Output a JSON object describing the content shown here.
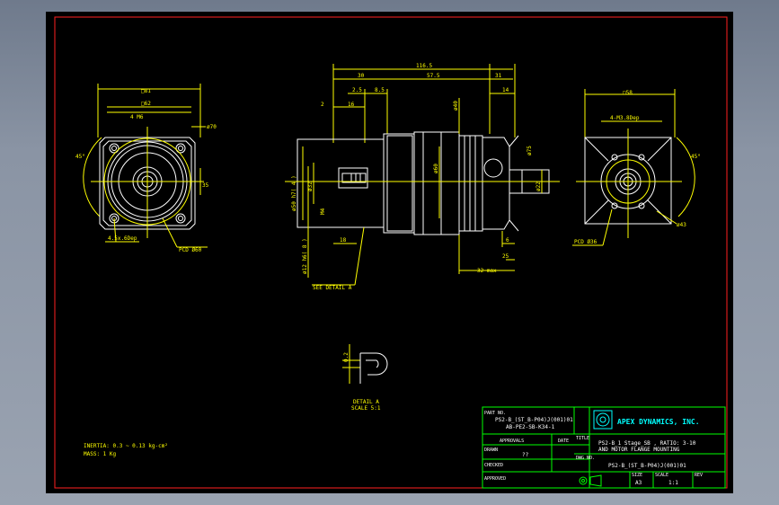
{
  "colors": {
    "background": "#000000",
    "border": "#ff2020",
    "dimension": "#ffff00",
    "outline": "#ffffff",
    "titleblock": "#00ff00",
    "logo": "#00ffff"
  },
  "views": {
    "front": {
      "square_outer": "□81",
      "square_inner": "□62",
      "holes": "4 M6",
      "pcd_circle": "ø70",
      "angle": "45°",
      "dim_side": "35",
      "bottom_left": "4.5x.6Dep",
      "pcd": "PCD Ø60"
    },
    "side": {
      "overall": "116.5",
      "seg1": "30",
      "seg2": "57.5",
      "seg3": "31",
      "seg4": "2.5",
      "seg5": "8.5",
      "seg6": "14",
      "small": "2",
      "d16": "16",
      "dia_body": "ø60",
      "dia_flange": "ø50 h7( 4 )",
      "dia_a": "ø32",
      "dia_shaft": "ø12 h6( 8 )",
      "dia_b": "ø40",
      "dia_c": "ø60",
      "m4": "M4",
      "d18": "18",
      "d6": "6",
      "d25": "25",
      "motor": "32 max",
      "right_dia": "ø75",
      "right_small": "ø22",
      "see_detail": "SEE DETAIL A"
    },
    "rear": {
      "square": "□58",
      "holes": "4-M3.8Dep",
      "angle": "45°",
      "pcd": "PCD Ø36",
      "dim": "ø43"
    },
    "detail": {
      "dim": "0.2",
      "label": "DETAIL A",
      "scale": "SCALE 5:1"
    }
  },
  "notes": {
    "inertia": "INERTIA: 0.3 ~ 0.13 kg-cm²",
    "mass": "MASS: 1  Kg"
  },
  "titleblock": {
    "part_no_label": "PART NO.",
    "part_no_1": "PS2-B_(ST_B-P04)J(001)01",
    "part_no_2": "AB-PE2-SB-K34-1",
    "approvals": "APPROVALS",
    "date": "DATE",
    "drawn": "DRAWN",
    "drawn_by": "??",
    "checked": "CHECKED",
    "approved": "APPROVED",
    "title_label": "TITLE",
    "title_1": "PS2-B_1 Stage_SB , RATIO: 3-10",
    "title_2": "AND MOTOR FLANGE MOUNTING",
    "dwg_label": "DWG NO.",
    "dwg_no": "PS2-B_(ST_B-P04)J(001)01",
    "size_label": "SIZE",
    "size": "A3",
    "scale_label": "SCALE",
    "scale": "1:1",
    "rev_label": "REV",
    "company": "APEX DYNAMICS, INC."
  }
}
